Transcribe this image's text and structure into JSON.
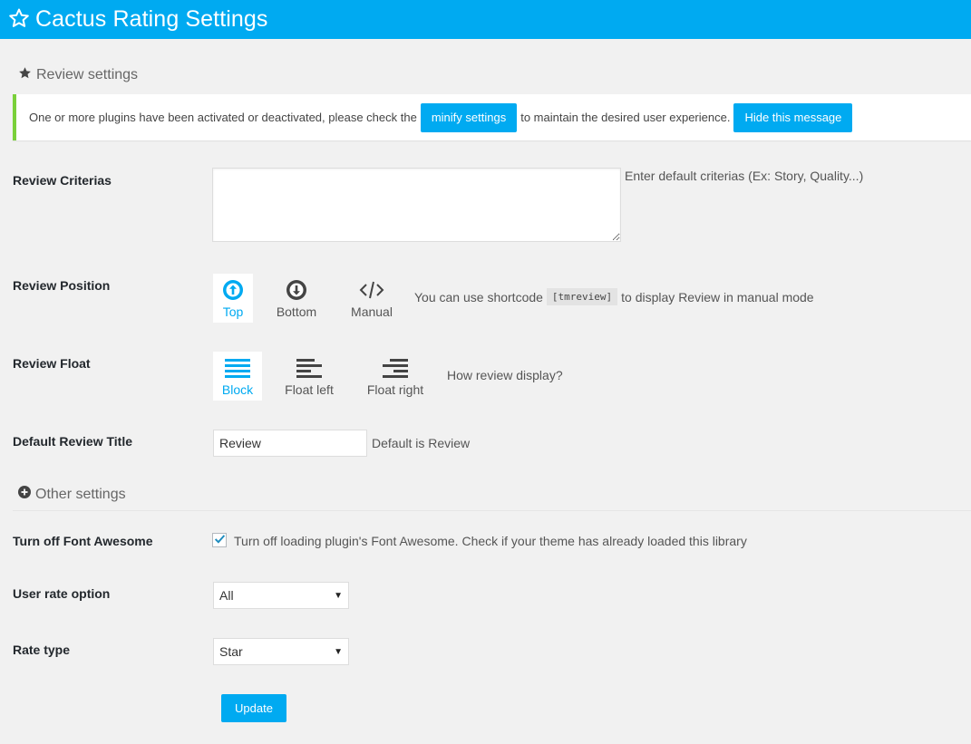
{
  "header": {
    "title": "Cactus Rating Settings",
    "icon": "star-outline-icon"
  },
  "review_section": {
    "title": "Review settings",
    "icon": "star-icon"
  },
  "notice": {
    "text_before": "One or more plugins have been activated or deactivated, please check the",
    "minify_button": "minify settings",
    "text_after": "to maintain the desired user experience.",
    "hide_button": "Hide this message",
    "accent": "#7ad03a"
  },
  "criterias": {
    "label": "Review Criterias",
    "value": "",
    "help": "Enter default criterias (Ex: Story, Quality...)"
  },
  "position": {
    "label": "Review Position",
    "options": [
      {
        "label": "Top",
        "icon": "arrow-circle-up-icon",
        "selected": true
      },
      {
        "label": "Bottom",
        "icon": "arrow-circle-down-icon",
        "selected": false
      },
      {
        "label": "Manual",
        "icon": "code-icon",
        "selected": false
      }
    ],
    "help_before": "You can use shortcode",
    "shortcode": "[tmreview]",
    "help_after": "to display Review in manual mode"
  },
  "float": {
    "label": "Review Float",
    "options": [
      {
        "label": "Block",
        "icon": "align-justify-icon",
        "selected": true
      },
      {
        "label": "Float left",
        "icon": "align-left-icon",
        "selected": false
      },
      {
        "label": "Float right",
        "icon": "align-right-icon",
        "selected": false
      }
    ],
    "help": "How review display?"
  },
  "default_title": {
    "label": "Default Review Title",
    "value": "Review",
    "help": "Default is Review"
  },
  "other_section": {
    "title": "Other settings",
    "icon": "plus-circle-icon"
  },
  "font_awesome": {
    "label": "Turn off Font Awesome",
    "checked": true,
    "text": "Turn off loading plugin's Font Awesome. Check if your theme has already loaded this library"
  },
  "user_rate": {
    "label": "User rate option",
    "value": "All"
  },
  "rate_type": {
    "label": "Rate type",
    "value": "Star"
  },
  "update_button": "Update",
  "colors": {
    "brand": "#00aaf1",
    "background": "#f1f1f1"
  }
}
